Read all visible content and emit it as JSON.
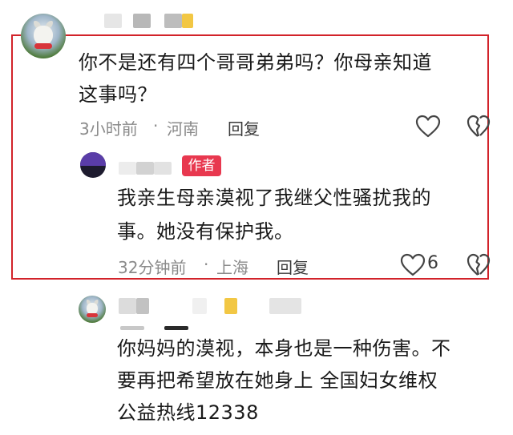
{
  "comments": [
    {
      "id": "c1",
      "text_lines": [
        "你不是还有四个哥哥弟弟吗？你母亲知道",
        "这事吗？"
      ],
      "time": "3小时前",
      "location": "河南",
      "reply_label": "回复"
    },
    {
      "id": "c2",
      "badge": "作者",
      "text_lines": [
        "我亲生母亲漠视了我继父性骚扰我的",
        "事。她没有保护我。"
      ],
      "time": "32分钟前",
      "location": "上海",
      "reply_label": "回复",
      "like_count": "6"
    },
    {
      "id": "c3",
      "text_lines": [
        "你妈妈的漠视，本身也是一种伤害。不",
        "要再把希望放在她身上  全国妇女维权",
        "公益热线12338"
      ]
    }
  ],
  "meta_separator": "·",
  "icons": [
    "avatar-cat",
    "avatar-author",
    "heart-outline-icon",
    "broken-heart-icon"
  ],
  "colors": {
    "highlight_border": "#d2232a",
    "author_badge": "#e8384f",
    "meta_text": "#8a8a8a"
  }
}
